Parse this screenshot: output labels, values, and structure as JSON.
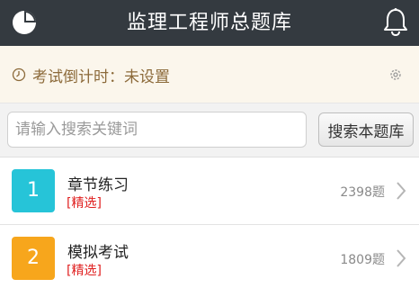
{
  "header": {
    "title": "监理工程师总题库",
    "left_icon": "pie-chart-icon",
    "right_icon": "bell-icon"
  },
  "countdown": {
    "text": "考试倒计时：未设置",
    "icon": "clock-icon",
    "settings_icon": "gear-icon"
  },
  "search": {
    "placeholder": "请输入搜索关键词",
    "value": "",
    "button_label": "搜索本题库"
  },
  "list": {
    "items": [
      {
        "number": "1",
        "name": "章节练习",
        "tag": "[精选]",
        "count": "2398题",
        "color": "#26c4d8"
      },
      {
        "number": "2",
        "name": "模拟考试",
        "tag": "[精选]",
        "count": "1809题",
        "color": "#f7a61c"
      }
    ]
  },
  "colors": {
    "header_bg": "#343a40",
    "countdown_bg": "#fbf6ec",
    "tag_red": "#e02020"
  }
}
